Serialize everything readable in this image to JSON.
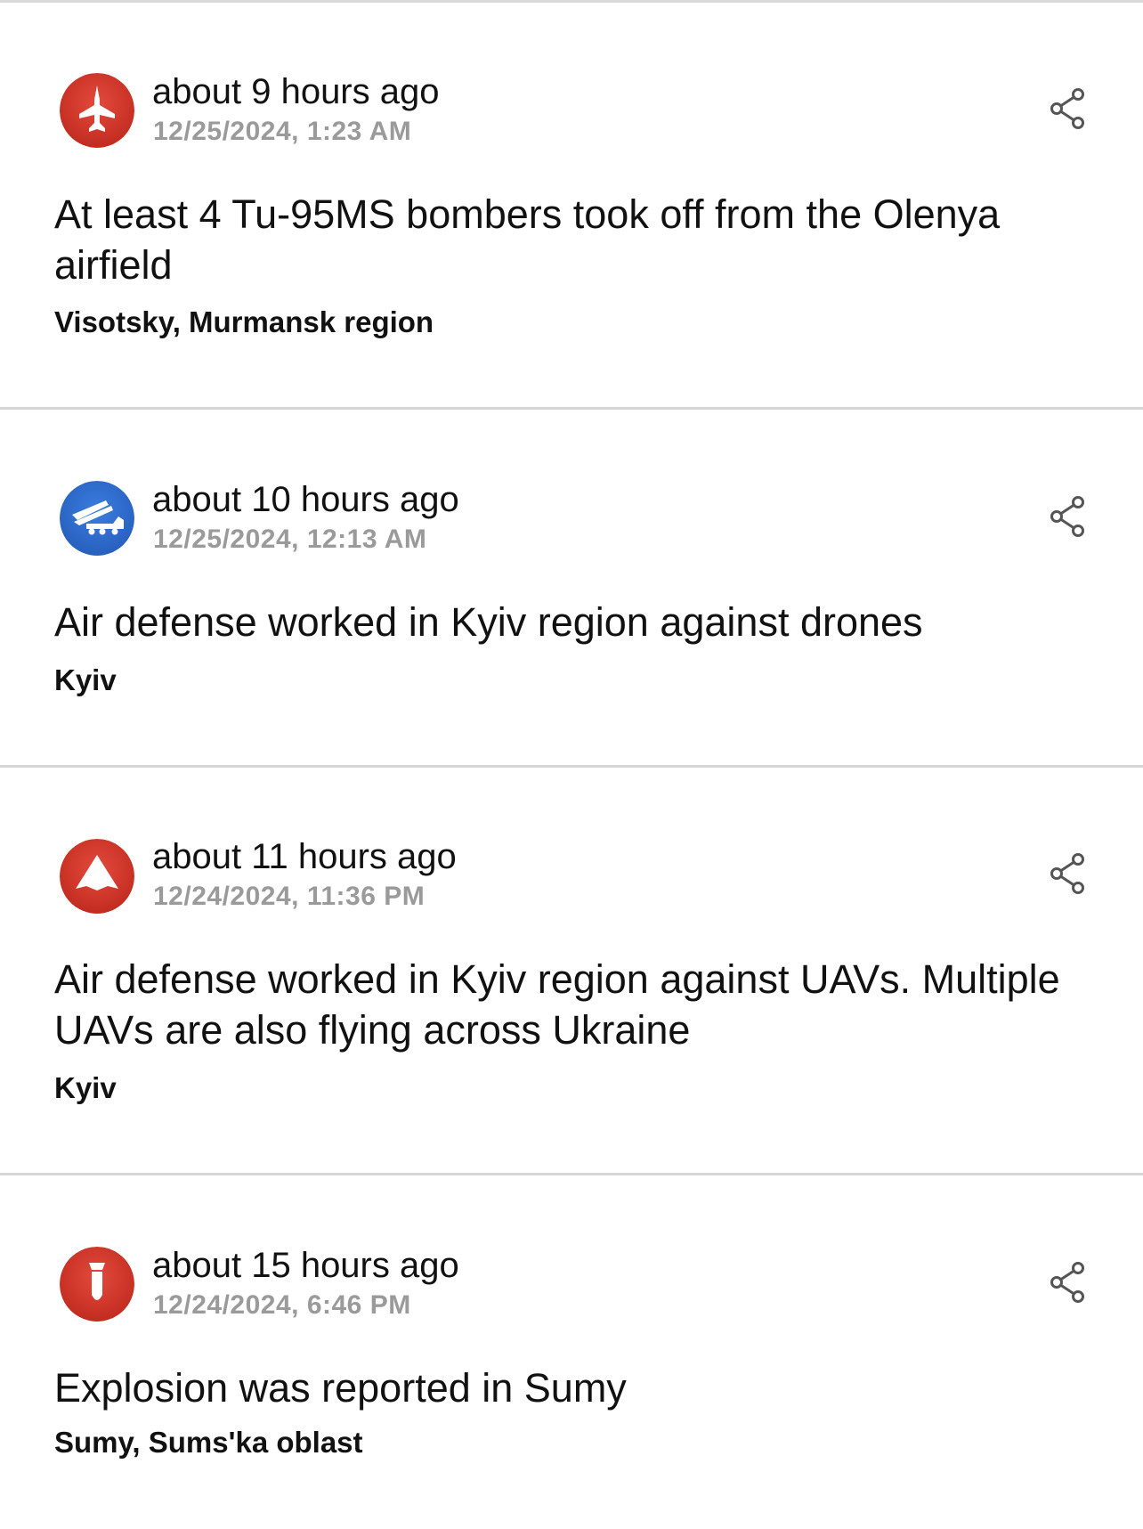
{
  "colors": {
    "alert_red": "#d33a2c",
    "info_blue": "#2f6fcf",
    "muted_text": "#9a9a9a",
    "divider": "#d6d6d6"
  },
  "events": [
    {
      "icon": "jet-aircraft-icon",
      "icon_color": "#d33a2c",
      "relative_time": "about 9 hours ago",
      "timestamp": "12/25/2024, 1:23 AM",
      "message": "At least 4 Tu-95MS bombers took off from the Olenya airfield",
      "location": "Visotsky, Murmansk region"
    },
    {
      "icon": "missile-launcher-icon",
      "icon_color": "#2f6fcf",
      "relative_time": "about 10 hours ago",
      "timestamp": "12/25/2024, 12:13 AM",
      "message": "Air defense worked in Kyiv region against drones",
      "location": "Kyiv"
    },
    {
      "icon": "drone-icon",
      "icon_color": "#d33a2c",
      "relative_time": "about 11 hours ago",
      "timestamp": "12/24/2024, 11:36 PM",
      "message": "Air defense worked in Kyiv region against UAVs. Multiple UAVs are also flying across Ukraine",
      "location": "Kyiv"
    },
    {
      "icon": "bomb-icon",
      "icon_color": "#d33a2c",
      "relative_time": "about 15 hours ago",
      "timestamp": "12/24/2024, 6:46 PM",
      "message": "Explosion was reported in Sumy",
      "location": "Sumy, Sums'ka oblast"
    }
  ]
}
